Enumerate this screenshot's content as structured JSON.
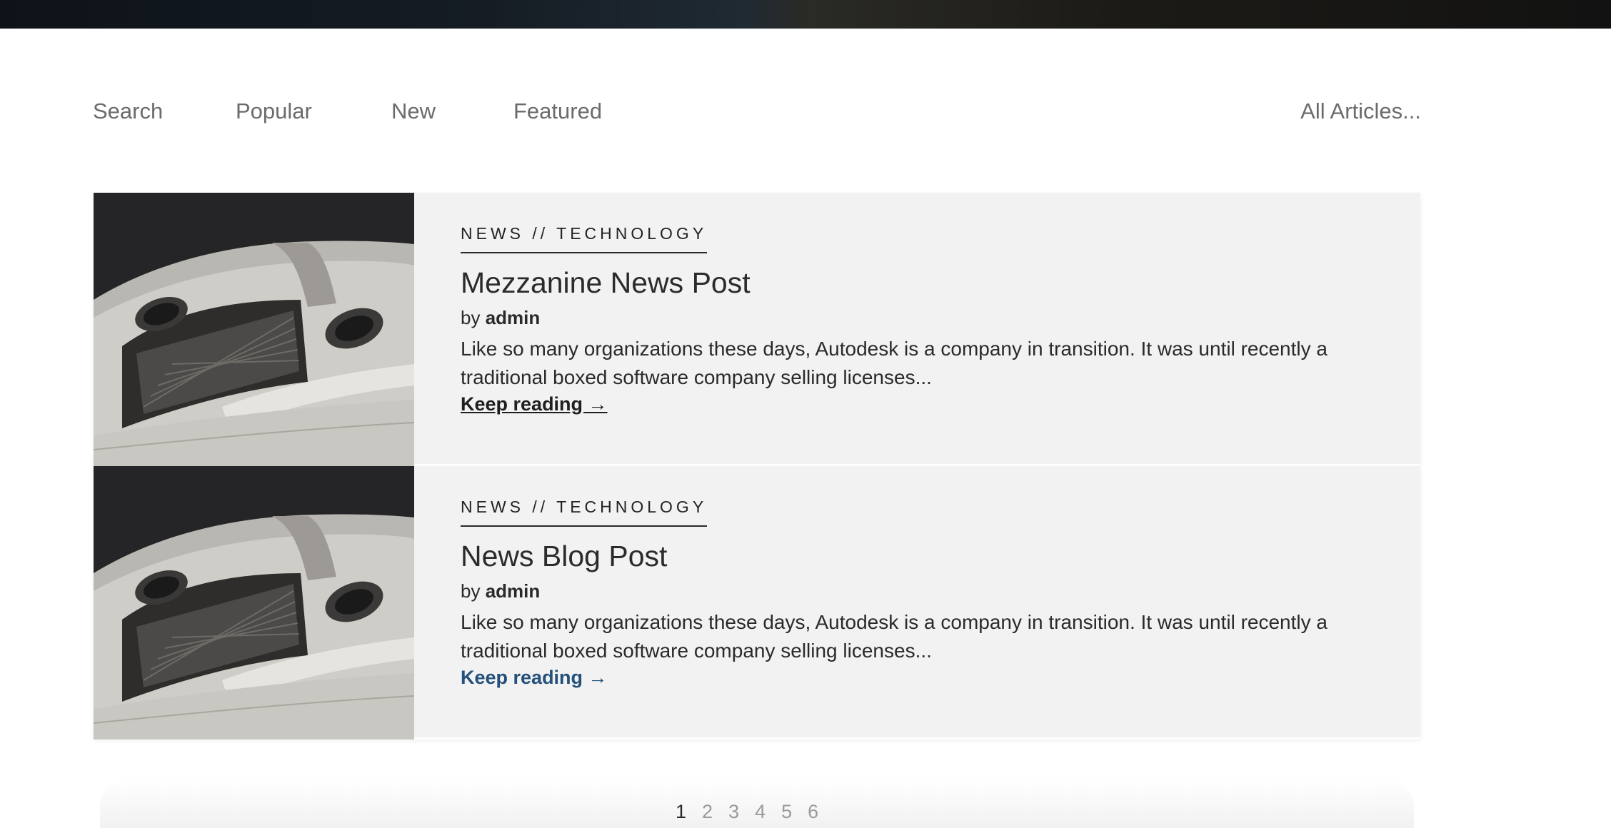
{
  "filters": {
    "search": "Search",
    "popular": "Popular",
    "new": "New",
    "featured": "Featured",
    "all_articles": "All Articles..."
  },
  "articles": [
    {
      "category": "NEWS // TECHNOLOGY",
      "title": "Mezzanine News Post",
      "by_prefix": "by",
      "author": "admin",
      "excerpt": "Like so many organizations these days, Autodesk is a company in transition. It was until recently a traditional boxed software company selling licenses...",
      "keep_reading": "Keep reading →"
    },
    {
      "category": "NEWS // TECHNOLOGY",
      "title": "News Blog Post",
      "by_prefix": "by",
      "author": "admin",
      "excerpt": "Like so many organizations these days, Autodesk is a company in transition. It was until recently a traditional boxed software company selling licenses...",
      "keep_reading": "Keep reading →"
    }
  ],
  "pagination": {
    "pages": [
      "1",
      "2",
      "3",
      "4",
      "5",
      "6"
    ],
    "current": "1"
  },
  "colors": {
    "card_background": "#f2f2f2",
    "link_accent": "#24507c",
    "filter_text": "#6b6b6b"
  }
}
